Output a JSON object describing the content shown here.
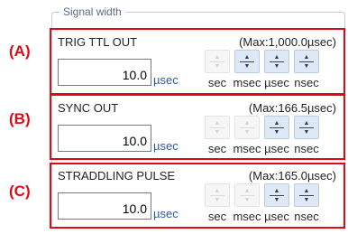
{
  "group": {
    "title": "Signal width"
  },
  "sections": [
    {
      "marker": "(A)",
      "label": "TRIG TTL OUT",
      "max": "(Max:1,000.0µsec)",
      "value": "10.0",
      "unit": "µsec",
      "cols": [
        "sec",
        "msec",
        "µsec",
        "nsec"
      ],
      "enabled": [
        false,
        true,
        true,
        true
      ]
    },
    {
      "marker": "(B)",
      "label": "SYNC OUT",
      "max": "(Max:166.5µsec)",
      "value": "10.0",
      "unit": "µsec",
      "cols": [
        "sec",
        "msec",
        "µsec",
        "nsec"
      ],
      "enabled": [
        false,
        false,
        true,
        true
      ]
    },
    {
      "marker": "(C)",
      "label": "STRADDLING PULSE",
      "max": "(Max:165.0µsec)",
      "value": "10.0",
      "unit": "µsec",
      "cols": [
        "sec",
        "msec",
        "µsec",
        "nsec"
      ],
      "enabled": [
        false,
        false,
        true,
        true
      ]
    }
  ],
  "icons": {
    "up": "spin-up-arrow-icon",
    "down": "spin-down-arrow-icon"
  },
  "colors": {
    "highlight": "#e00a14",
    "unit_text": "#2a5ca8",
    "group_title": "#5a6a7d"
  }
}
